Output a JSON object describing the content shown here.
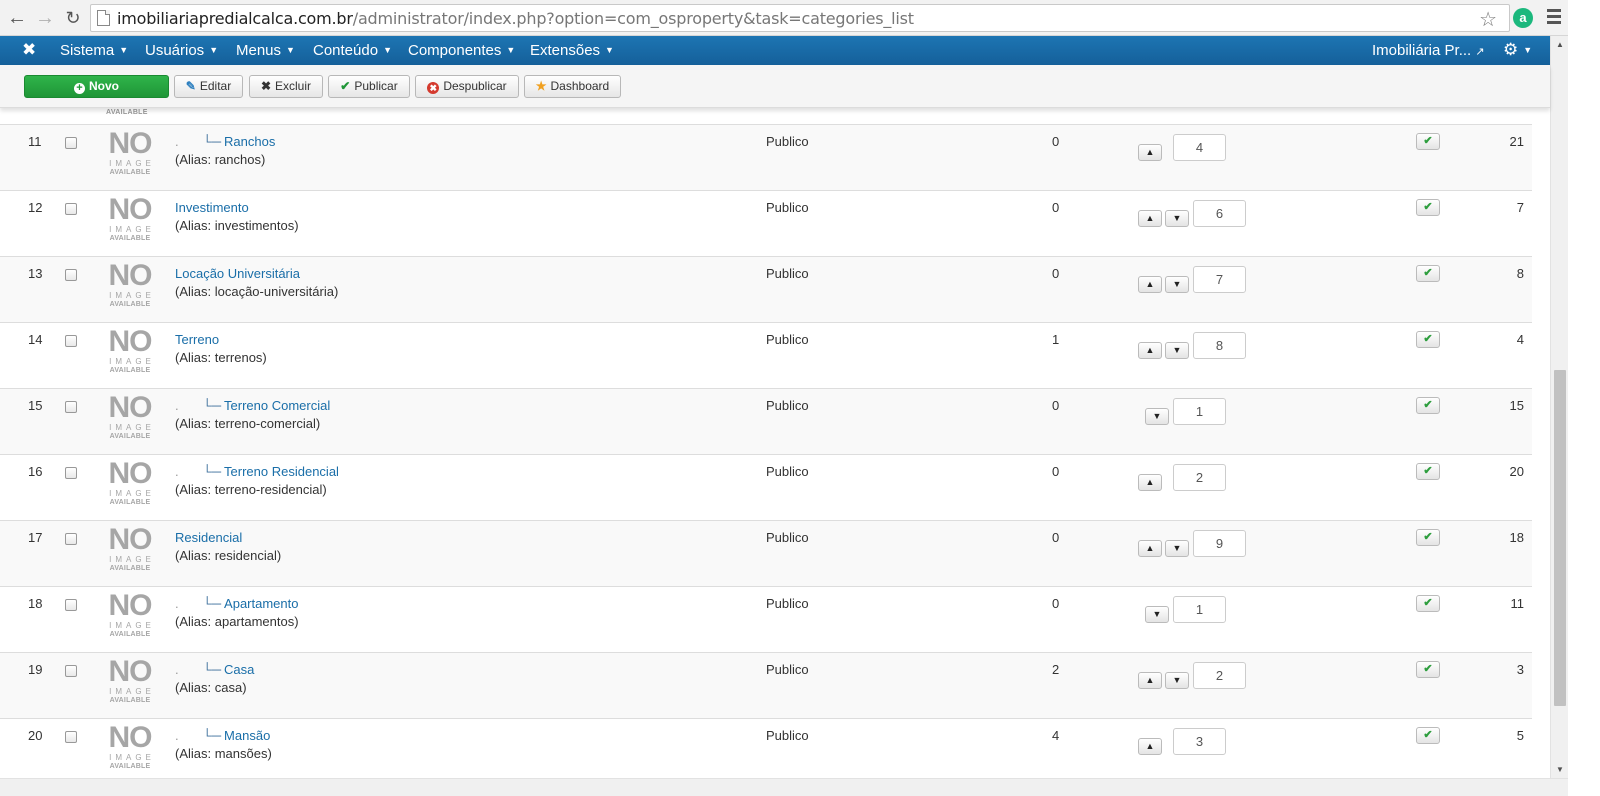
{
  "browser": {
    "url_host": "imobiliariapredialcalca.com.br",
    "url_path": "/administrator/index.php?option=com_osproperty&task=categories_list"
  },
  "topnav": {
    "items": [
      "Sistema",
      "Usuários",
      "Menus",
      "Conteúdo",
      "Componentes",
      "Extensões"
    ],
    "site_link": "Imobiliária Pr..."
  },
  "toolbar": {
    "novo": "Novo",
    "editar": "Editar",
    "excluir": "Excluir",
    "publicar": "Publicar",
    "despublicar": "Despublicar",
    "dashboard": "Dashboard"
  },
  "noimage": {
    "no": "NO",
    "image": "IMAGE",
    "available": "AVAILABLE"
  },
  "rows": [
    {
      "num": "11",
      "name": "Ranchos",
      "alias": "(Alias: ranchos)",
      "child": true,
      "access": "Publico",
      "count": "0",
      "up": true,
      "down": false,
      "order": "4",
      "id": "21"
    },
    {
      "num": "12",
      "name": "Investimento",
      "alias": "(Alias: investimentos)",
      "child": false,
      "access": "Publico",
      "count": "0",
      "up": true,
      "down": true,
      "order": "6",
      "id": "7"
    },
    {
      "num": "13",
      "name": "Locação Universitária",
      "alias": "(Alias: locação-universitária)",
      "child": false,
      "access": "Publico",
      "count": "0",
      "up": true,
      "down": true,
      "order": "7",
      "id": "8"
    },
    {
      "num": "14",
      "name": "Terreno",
      "alias": "(Alias: terrenos)",
      "child": false,
      "access": "Publico",
      "count": "1",
      "up": true,
      "down": true,
      "order": "8",
      "id": "4"
    },
    {
      "num": "15",
      "name": "Terreno Comercial",
      "alias": "(Alias: terreno-comercial)",
      "child": true,
      "access": "Publico",
      "count": "0",
      "up": false,
      "down": true,
      "order": "1",
      "id": "15"
    },
    {
      "num": "16",
      "name": "Terreno Residencial",
      "alias": "(Alias: terreno-residencial)",
      "child": true,
      "access": "Publico",
      "count": "0",
      "up": true,
      "down": false,
      "order": "2",
      "id": "20"
    },
    {
      "num": "17",
      "name": "Residencial",
      "alias": "(Alias: residencial)",
      "child": false,
      "access": "Publico",
      "count": "0",
      "up": true,
      "down": true,
      "order": "9",
      "id": "18"
    },
    {
      "num": "18",
      "name": "Apartamento",
      "alias": "(Alias: apartamentos)",
      "child": true,
      "access": "Publico",
      "count": "0",
      "up": false,
      "down": true,
      "order": "1",
      "id": "11"
    },
    {
      "num": "19",
      "name": "Casa",
      "alias": "(Alias: casa)",
      "child": true,
      "access": "Publico",
      "count": "2",
      "up": true,
      "down": true,
      "order": "2",
      "id": "3"
    },
    {
      "num": "20",
      "name": "Mansão",
      "alias": "(Alias: mansões)",
      "child": true,
      "access": "Publico",
      "count": "4",
      "up": true,
      "down": false,
      "order": "3",
      "id": "5"
    }
  ]
}
